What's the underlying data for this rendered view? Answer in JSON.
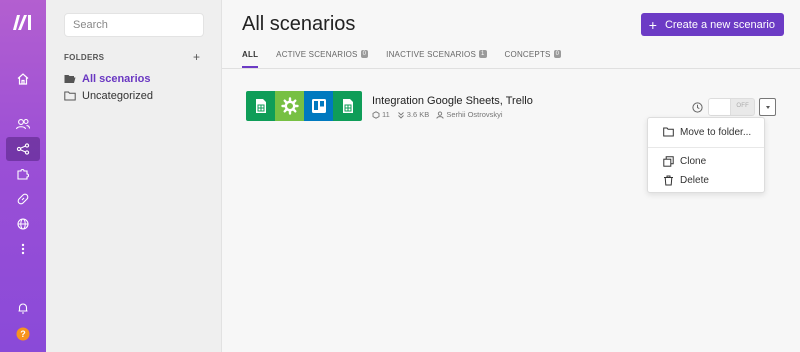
{
  "sidebar": {
    "items": [
      {
        "name": "home-icon"
      },
      {
        "name": "team-icon"
      },
      {
        "name": "scenarios-icon"
      },
      {
        "name": "apps-icon"
      },
      {
        "name": "connections-icon"
      },
      {
        "name": "webhooks-icon"
      },
      {
        "name": "more-icon"
      },
      {
        "name": "notifications-icon"
      },
      {
        "name": "help-icon"
      }
    ]
  },
  "folders": {
    "search_placeholder": "Search",
    "heading": "FOLDERS",
    "add_label": "+",
    "items": [
      {
        "label": "All scenarios"
      },
      {
        "label": "Uncategorized"
      }
    ]
  },
  "header": {
    "title": "All scenarios",
    "create_button": "Create a new scenario",
    "create_plus": "+"
  },
  "tabs": [
    {
      "label": "ALL",
      "count": ""
    },
    {
      "label": "ACTIVE SCENARIOS",
      "count": "0"
    },
    {
      "label": "INACTIVE SCENARIOS",
      "count": "1"
    },
    {
      "label": "CONCEPTS",
      "count": "0"
    }
  ],
  "scenario": {
    "name": "Integration Google Sheets, Trello",
    "operations": "11",
    "data_size": "3.6 KB",
    "owner": "Serhii Ostrovskyi",
    "toggle_label": "OFF",
    "app_icons": [
      "google-sheets-icon",
      "tools-icon",
      "trello-icon",
      "google-sheets-icon"
    ]
  },
  "dropdown_menu": {
    "items": [
      {
        "label": "Move to folder..."
      },
      {
        "label": "Clone"
      },
      {
        "label": "Delete"
      }
    ]
  },
  "colors": {
    "brand": "#6c3bc5",
    "sheets_green": "#0f9d58",
    "tools_green": "#77c043",
    "trello_blue": "#0079bf",
    "help_orange": "#f7931e"
  }
}
